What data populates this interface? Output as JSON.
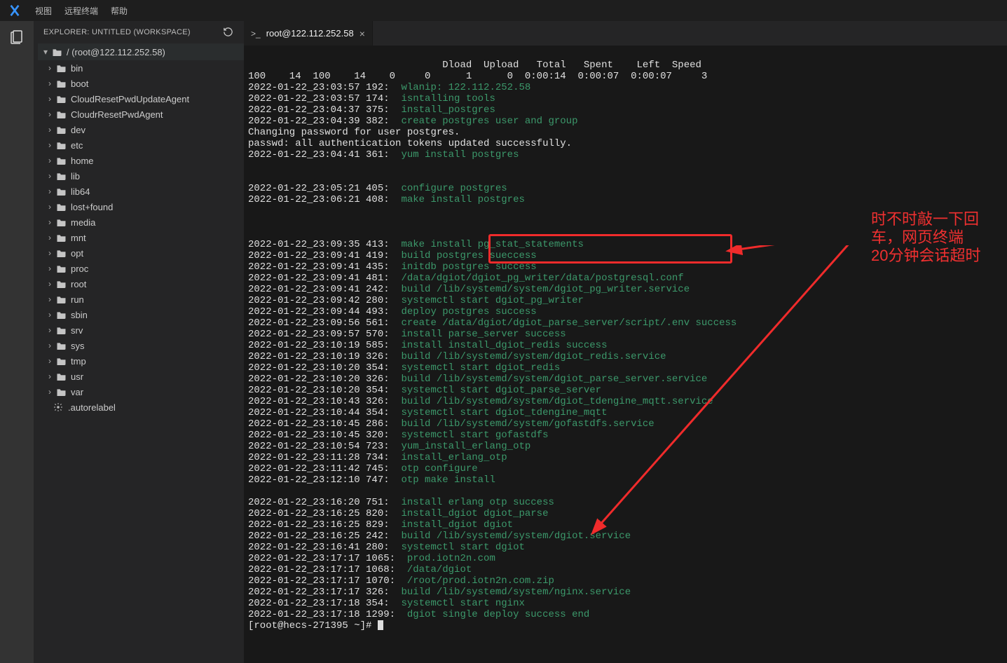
{
  "menubar": {
    "items": [
      "视图",
      "远程终端",
      "帮助"
    ]
  },
  "sidebar": {
    "title": "EXPLORER: UNTITLED (WORKSPACE)",
    "root": "/ (root@122.112.252.58)",
    "folders": [
      "bin",
      "boot",
      "CloudResetPwdUpdateAgent",
      "CloudrResetPwdAgent",
      "dev",
      "etc",
      "home",
      "lib",
      "lib64",
      "lost+found",
      "media",
      "mnt",
      "opt",
      "proc",
      "root",
      "run",
      "sbin",
      "srv",
      "sys",
      "tmp",
      "usr",
      "var"
    ],
    "file": ".autorelabel"
  },
  "tab": {
    "title": "root@122.112.252.58",
    "prefix": ">_"
  },
  "dl_header": "                                 Dload  Upload   Total   Spent    Left  Speed",
  "dl_line": "100    14  100    14    0     0      1      0  0:00:14  0:00:07  0:00:07     3",
  "plain1": "Changing password for user postgres.",
  "plain2": "passwd: all authentication tokens updated successfully.",
  "prompt": "[root@hecs-271395 ~]# ",
  "annot": {
    "l1": "时不时敲一下回车，网页终端",
    "l2": "20分钟会话超时"
  },
  "logs": [
    [
      "2022-01-22_23:03:57 192:  ",
      "wlanip: 122.112.252.58"
    ],
    [
      "2022-01-22_23:03:57 174:  ",
      "isntalling tools"
    ],
    [
      "2022-01-22_23:04:37 375:  ",
      "install_postgres"
    ],
    [
      "2022-01-22_23:04:39 382:  ",
      "create postgres user and group"
    ],
    [
      "__plain1__",
      ""
    ],
    [
      "__plain2__",
      ""
    ],
    [
      "2022-01-22_23:04:41 361:  ",
      "yum install postgres"
    ],
    [
      "",
      ""
    ],
    [
      "",
      ""
    ],
    [
      "2022-01-22_23:05:21 405:  ",
      "configure postgres"
    ],
    [
      "2022-01-22_23:06:21 408:  ",
      "make install postgres"
    ],
    [
      "",
      ""
    ],
    [
      "",
      ""
    ],
    [
      "",
      ""
    ],
    [
      "2022-01-22_23:09:35 413:  ",
      "make install pg_stat_statements"
    ],
    [
      "2022-01-22_23:09:41 419:  ",
      "build postgres sueccess"
    ],
    [
      "2022-01-22_23:09:41 435:  ",
      "initdb postgres success"
    ],
    [
      "2022-01-22_23:09:41 481:  ",
      "/data/dgiot/dgiot_pg_writer/data/postgresql.conf"
    ],
    [
      "2022-01-22_23:09:41 242:  ",
      "build /lib/systemd/system/dgiot_pg_writer.service"
    ],
    [
      "2022-01-22_23:09:42 280:  ",
      "systemctl start dgiot_pg_writer"
    ],
    [
      "2022-01-22_23:09:44 493:  ",
      "deploy postgres success"
    ],
    [
      "2022-01-22_23:09:56 561:  ",
      "create /data/dgiot/dgiot_parse_server/script/.env success"
    ],
    [
      "2022-01-22_23:09:57 570:  ",
      "install parse_server success"
    ],
    [
      "2022-01-22_23:10:19 585:  ",
      "install install_dgiot_redis success"
    ],
    [
      "2022-01-22_23:10:19 326:  ",
      "build /lib/systemd/system/dgiot_redis.service"
    ],
    [
      "2022-01-22_23:10:20 354:  ",
      "systemctl start dgiot_redis"
    ],
    [
      "2022-01-22_23:10:20 326:  ",
      "build /lib/systemd/system/dgiot_parse_server.service"
    ],
    [
      "2022-01-22_23:10:20 354:  ",
      "systemctl start dgiot_parse_server"
    ],
    [
      "2022-01-22_23:10:43 326:  ",
      "build /lib/systemd/system/dgiot_tdengine_mqtt.service"
    ],
    [
      "2022-01-22_23:10:44 354:  ",
      "systemctl start dgiot_tdengine_mqtt"
    ],
    [
      "2022-01-22_23:10:45 286:  ",
      "build /lib/systemd/system/gofastdfs.service"
    ],
    [
      "2022-01-22_23:10:45 320:  ",
      "systemctl start gofastdfs"
    ],
    [
      "2022-01-22_23:10:54 723:  ",
      "yum_install_erlang_otp"
    ],
    [
      "2022-01-22_23:11:28 734:  ",
      "install_erlang_otp"
    ],
    [
      "2022-01-22_23:11:42 745:  ",
      "otp configure"
    ],
    [
      "2022-01-22_23:12:10 747:  ",
      "otp make install"
    ],
    [
      "",
      ""
    ],
    [
      "2022-01-22_23:16:20 751:  ",
      "install erlang otp success"
    ],
    [
      "2022-01-22_23:16:25 820:  ",
      "install_dgiot dgiot_parse"
    ],
    [
      "2022-01-22_23:16:25 829:  ",
      "install_dgiot dgiot"
    ],
    [
      "2022-01-22_23:16:25 242:  ",
      "build /lib/systemd/system/dgiot.service"
    ],
    [
      "2022-01-22_23:16:41 280:  ",
      "systemctl start dgiot"
    ],
    [
      "2022-01-22_23:17:17 1065:  ",
      "prod.iotn2n.com"
    ],
    [
      "2022-01-22_23:17:17 1068:  ",
      "/data/dgiot"
    ],
    [
      "2022-01-22_23:17:17 1070:  ",
      "/root/prod.iotn2n.com.zip"
    ],
    [
      "2022-01-22_23:17:17 326:  ",
      "build /lib/systemd/system/nginx.service"
    ],
    [
      "2022-01-22_23:17:18 354:  ",
      "systemctl start nginx"
    ],
    [
      "2022-01-22_23:17:18 1299:  ",
      "dgiot single deploy success end"
    ]
  ]
}
